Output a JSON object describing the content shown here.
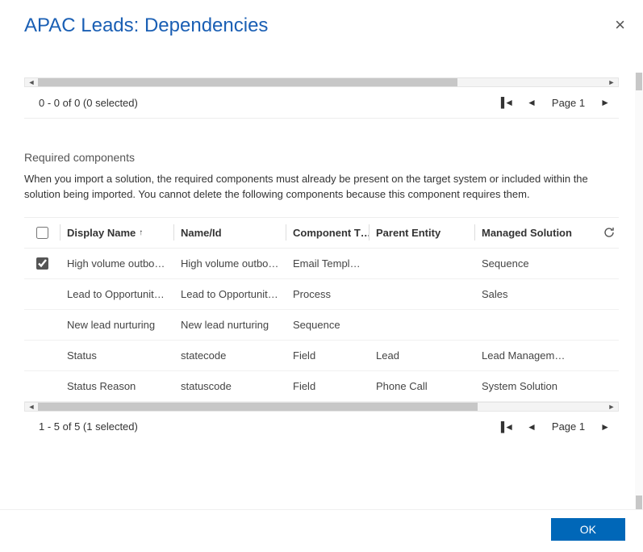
{
  "dialog": {
    "title": "APAC Leads: Dependencies"
  },
  "pager1": {
    "status": "0 - 0 of 0 (0 selected)",
    "page_label": "Page 1"
  },
  "section": {
    "title": "Required components",
    "description": "When you import a solution, the required components must already be present on the target system or included within the solution being imported. You cannot delete the following components because this component requires them."
  },
  "grid": {
    "headers": {
      "display_name": "Display Name",
      "name_id": "Name/Id",
      "component_type": "Component T…",
      "parent_entity": "Parent Entity",
      "managed_solution": "Managed Solution"
    },
    "rows": [
      {
        "checked": true,
        "display_name": "High volume outbou…",
        "name_id": "High volume outbou…",
        "component_type": "Email Template",
        "parent_entity": "",
        "managed_solution": "Sequence"
      },
      {
        "checked": false,
        "display_name": "Lead to Opportunity…",
        "name_id": "Lead to Opportunity…",
        "component_type": "Process",
        "parent_entity": "",
        "managed_solution": "Sales"
      },
      {
        "checked": false,
        "display_name": "New lead nurturing",
        "name_id": "New lead nurturing",
        "component_type": "Sequence",
        "parent_entity": "",
        "managed_solution": ""
      },
      {
        "checked": false,
        "display_name": "Status",
        "name_id": "statecode",
        "component_type": "Field",
        "parent_entity": "Lead",
        "managed_solution": "Lead Management"
      },
      {
        "checked": false,
        "display_name": "Status Reason",
        "name_id": "statuscode",
        "component_type": "Field",
        "parent_entity": "Phone Call",
        "managed_solution": "System Solution"
      }
    ]
  },
  "pager2": {
    "status": "1 - 5 of 5 (1 selected)",
    "page_label": "Page 1"
  },
  "buttons": {
    "ok": "OK"
  }
}
